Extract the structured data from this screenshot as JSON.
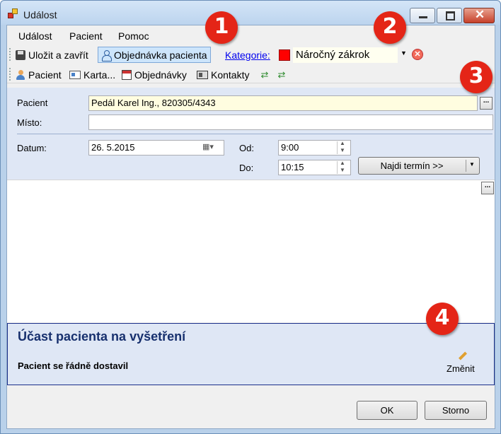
{
  "window": {
    "title": "Událost"
  },
  "menu": [
    {
      "label": "Událost"
    },
    {
      "label": "Pacient"
    },
    {
      "label": "Pomoc"
    }
  ],
  "toolbar1": {
    "save_close": "Uložit a zavřít",
    "patient_order": "Objednávka pacienta",
    "category_link": "Kategorie:",
    "category_value": "Náročný zákrok",
    "category_color": "#ff0000"
  },
  "toolbar2": {
    "patient": "Pacient",
    "card": "Karta...",
    "orders": "Objednávky",
    "contacts": "Kontakty"
  },
  "form": {
    "patient_label": "Pacient",
    "patient_value": "Pedál Karel Ing., 820305/4343",
    "place_label": "Místo:",
    "place_value": "",
    "date_label": "Datum:",
    "date_value": "26.  5.2015",
    "from_label": "Od:",
    "from_value": "9:00",
    "to_label": "Do:",
    "to_value": "10:15",
    "find_button": "Najdi termín >>"
  },
  "participation": {
    "title": "Účast pacienta na vyšetření",
    "status": "Pacient se řádně dostavil",
    "change": "Změnit"
  },
  "buttons": {
    "ok": "OK",
    "cancel": "Storno"
  },
  "callouts": [
    "1",
    "2",
    "3",
    "4"
  ]
}
